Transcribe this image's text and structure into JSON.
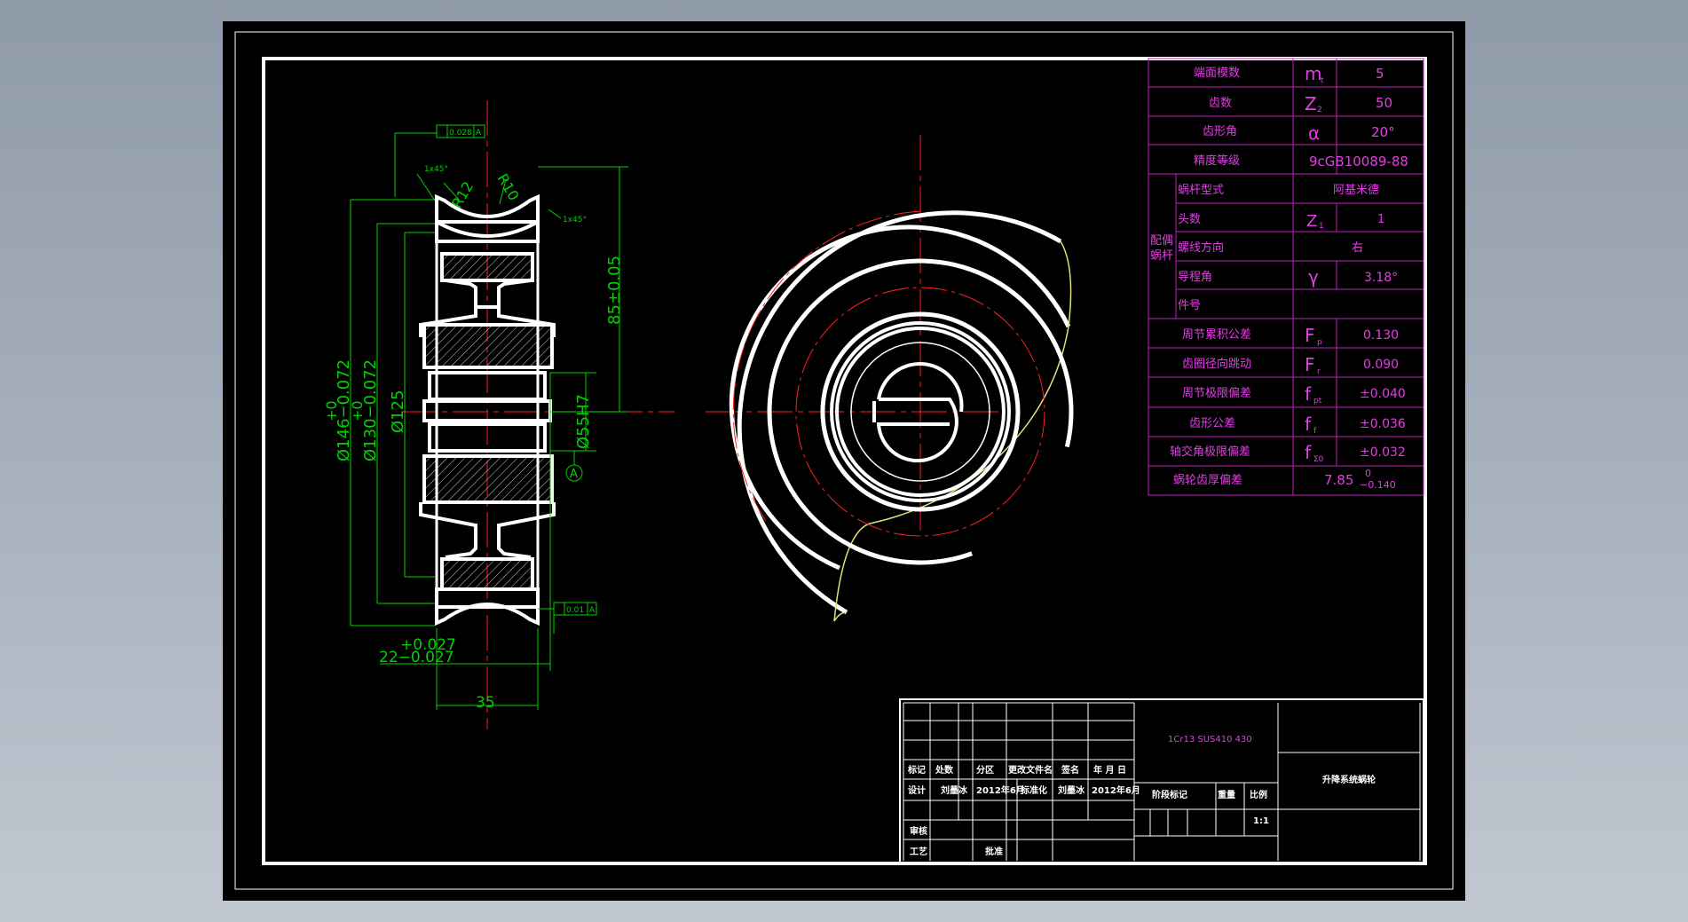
{
  "colors": {
    "background_outer": "#a3adb9",
    "paper": "#000000",
    "frame": "#ffffff",
    "table_line": "#c020c0",
    "table_text": "#e040e0",
    "dimension": "#00d200",
    "centerline": "#ff2020",
    "title_text": "#ffffff",
    "material_text": "#e040e0",
    "outline_yellow": "#e6e07a"
  },
  "param_table": {
    "rows": [
      {
        "name": "端面模数",
        "symbol": "m",
        "sub": "t",
        "value": "5"
      },
      {
        "name": "齿数",
        "symbol": "Z",
        "sub": "2",
        "value": "50"
      },
      {
        "name": "齿形角",
        "symbol": "α",
        "sub": "",
        "value": "20°"
      },
      {
        "name": "精度等级",
        "symbol": "",
        "sub": "",
        "value": "9cGB10089-88"
      }
    ],
    "mating_label_1": "配偶",
    "mating_label_2": "蜗杆",
    "mating_rows": [
      {
        "name": "蜗杆型式",
        "symbol": "",
        "sub": "",
        "value": "阿基米德"
      },
      {
        "name": "头数",
        "symbol": "Z",
        "sub": "1",
        "value": "1"
      },
      {
        "name": "螺线方向",
        "symbol": "",
        "sub": "",
        "value": "右"
      },
      {
        "name": "导程角",
        "symbol": "γ",
        "sub": "",
        "value": "3.18°"
      },
      {
        "name": "件号",
        "symbol": "",
        "sub": "",
        "value": ""
      }
    ],
    "tolerance_rows": [
      {
        "name": "周节累积公差",
        "symbol": "F",
        "sub": "p",
        "value": "0.130"
      },
      {
        "name": "齿圈径向跳动",
        "symbol": "F",
        "sub": "r",
        "value": "0.090"
      },
      {
        "name": "周节极限偏差",
        "symbol": "f",
        "sub": "pt",
        "value": "±0.040"
      },
      {
        "name": "齿形公差",
        "symbol": "f",
        "sub": "f",
        "value": "±0.036"
      },
      {
        "name": "轴交角极限偏差",
        "symbol": "f",
        "sub": "Σ0",
        "value": "±0.032"
      }
    ],
    "thickness_row": {
      "name": "蜗轮齿厚偏差",
      "value": "7.85",
      "upper": "0",
      "lower": "−0.140"
    }
  },
  "dimensions": {
    "tol_top": "0.028",
    "tol_top_datum": "A",
    "tol_bottom": "0.01",
    "tol_bottom_datum": "A",
    "chamfer_left": "1x45°",
    "chamfer_right": "1x45°",
    "r12": "R12",
    "r10": "R10",
    "d146": "Ø146−0.072",
    "d146_upper": "+0",
    "d130": "Ø130−0.072",
    "d130_upper": "+0",
    "d125": "Ø125",
    "d55": "Ø55H7",
    "h85": "85±0.05",
    "w22_upper": "+0.027",
    "w22": "22−0.027",
    "w35": "35",
    "datum": "A"
  },
  "title_block": {
    "material": "1Cr13 SUS410 430",
    "drawing_name": "升降系统蜗轮",
    "headers": [
      "标记",
      "处数",
      "分区",
      "更改文件名",
      "签名",
      "年 月 日"
    ],
    "design_row": [
      "设计",
      "刘墨冰",
      "2012年6月",
      "标准化",
      "刘墨冰",
      "2012年6月"
    ],
    "stage_label": "阶段标记",
    "weight_label": "重量",
    "scale_label": "比例",
    "scale_value": "1:1",
    "review_label": "审核",
    "process_label": "工艺",
    "approve_label": "批准"
  }
}
